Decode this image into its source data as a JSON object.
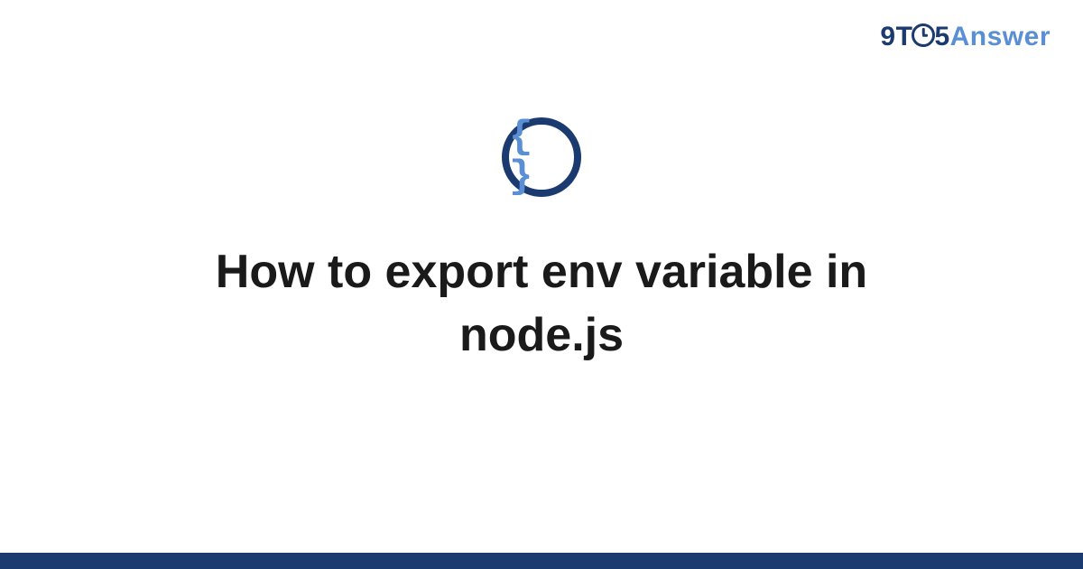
{
  "logo": {
    "part1": "9T",
    "part2": "5",
    "part3": "Answer"
  },
  "icon": {
    "braces": "{ }"
  },
  "title": "How to export env variable in node.js",
  "colors": {
    "brand_dark": "#1a3a70",
    "brand_light": "#5a8fd6",
    "text": "#1a1a1a"
  }
}
